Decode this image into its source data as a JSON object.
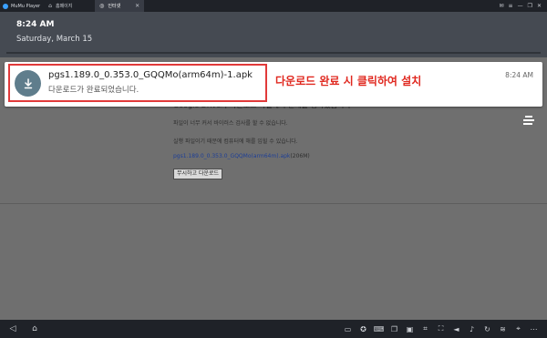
{
  "titlebar": {
    "app_name": "MuMu Player",
    "tabs": [
      {
        "label": "홈페이지",
        "active": false
      },
      {
        "label": "인터넷",
        "active": true
      }
    ],
    "controls": [
      "✉",
      "≡",
      "—",
      "❐",
      "✕"
    ]
  },
  "shade": {
    "time": "8:24 AM",
    "date": "Saturday, March 15"
  },
  "notification": {
    "title": "pgs1.189.0_0.353.0_GQQMo(arm64m)-1.apk",
    "subtitle": "다운로드가 완료되었습니다.",
    "time": "8:24 AM",
    "annotation": "다운로드 완료 시 클릭하여 설치",
    "icon": "download-icon"
  },
  "page": {
    "heading": "Google Drive가 다운로드 파일에서 문제를 검사했습니다",
    "line1": "파일이 너무 커서 바이러스 검사를 할 수 없습니다.",
    "line2": "실행 파일이기 때문에 컴퓨터에 해를 입힐 수 있습니다.",
    "file_link": "pgs1.189.0_0.353.0_GQQMo(arm64m).apk",
    "file_size": "(206M)",
    "button": "무시하고 다운로드"
  },
  "colors": {
    "highlight": "#e13a3a",
    "annotation": "#e0281f",
    "link": "#1e3f96"
  }
}
